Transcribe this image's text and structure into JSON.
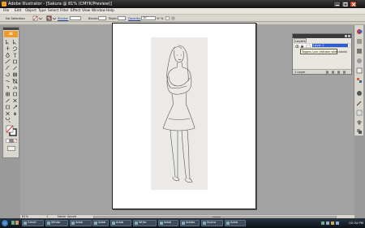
{
  "window": {
    "title": "Adobe Illustrator - [Sakura @ 81% (CMYK/Preview)]"
  },
  "menu": [
    "File",
    "Edit",
    "Object",
    "Type",
    "Select",
    "Filter",
    "Effect",
    "View",
    "Window",
    "Help"
  ],
  "control_bar": {
    "selection": "No Selection",
    "stroke_label": "Stroke:",
    "brush_label": "Brush:",
    "style_label": "Style:",
    "opacity_label": "Opacity:",
    "opacity_value": "10",
    "opacity_unit": "%"
  },
  "layers_panel": {
    "tab": "Layers",
    "layer_name": "Layer 1",
    "tooltip": "Toggles Lock (editable when blank)",
    "count": "1 Layer"
  },
  "status_bar": {
    "zoom": "81%",
    "page": "1",
    "status": "Never Saved"
  },
  "taskbar": {
    "tasks": [
      "Gmail",
      "Windo",
      "Adob",
      "Adob",
      "Adob",
      "Write",
      "Adob",
      "Adobe",
      "Ilustra",
      "Adob"
    ],
    "clock": "02:34 PM"
  },
  "colors": {
    "titlebar": "#1a1a1a",
    "accent": "#f09a26",
    "selection": "#2e5bd6"
  },
  "icons": {
    "start": "windows-orb-icon",
    "tools": [
      "selection-tool-icon",
      "direct-selection-tool-icon",
      "magic-wand-icon",
      "lasso-icon",
      "pen-tool-icon",
      "type-tool-icon",
      "line-tool-icon",
      "rectangle-tool-icon",
      "paintbrush-icon",
      "pencil-icon",
      "rotate-icon",
      "scale-icon",
      "warp-icon",
      "free-transform-icon",
      "symbol-sprayer-icon",
      "column-graph-icon",
      "mesh-icon",
      "gradient-icon",
      "eyedropper-icon",
      "blend-icon",
      "live-paint-icon",
      "slice-icon",
      "scissors-icon",
      "hand-icon",
      "zoom-icon"
    ]
  }
}
